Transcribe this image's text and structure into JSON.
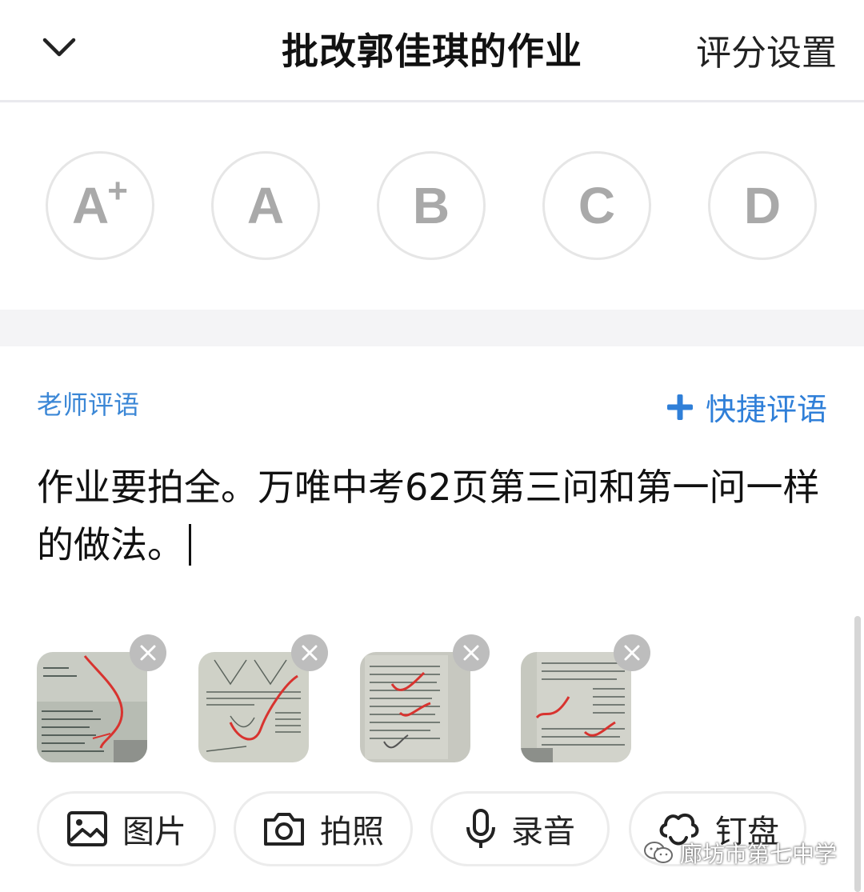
{
  "header": {
    "title": "批改郭佳琪的作业",
    "settings_label": "评分设置"
  },
  "grades": {
    "options": [
      {
        "letter": "A",
        "plus": "+"
      },
      {
        "letter": "A",
        "plus": ""
      },
      {
        "letter": "B",
        "plus": ""
      },
      {
        "letter": "C",
        "plus": ""
      },
      {
        "letter": "D",
        "plus": ""
      }
    ]
  },
  "comment": {
    "label": "老师评语",
    "quick_label": "快捷评语",
    "text": "作业要拍全。万唯中考62页第三问和第一问一样的做法。"
  },
  "attachments": [
    {
      "icon": "homework-photo-1"
    },
    {
      "icon": "homework-photo-2"
    },
    {
      "icon": "homework-photo-3"
    },
    {
      "icon": "homework-photo-4"
    }
  ],
  "tools": {
    "image_label": "图片",
    "photo_label": "拍照",
    "record_label": "录音",
    "dingpan_label": "钉盘"
  },
  "watermark": {
    "text": "廊坊市第七中学"
  },
  "colors": {
    "accent": "#2f7fd8",
    "grade_text": "#a9a9a9",
    "divider": "#f4f4f6"
  }
}
